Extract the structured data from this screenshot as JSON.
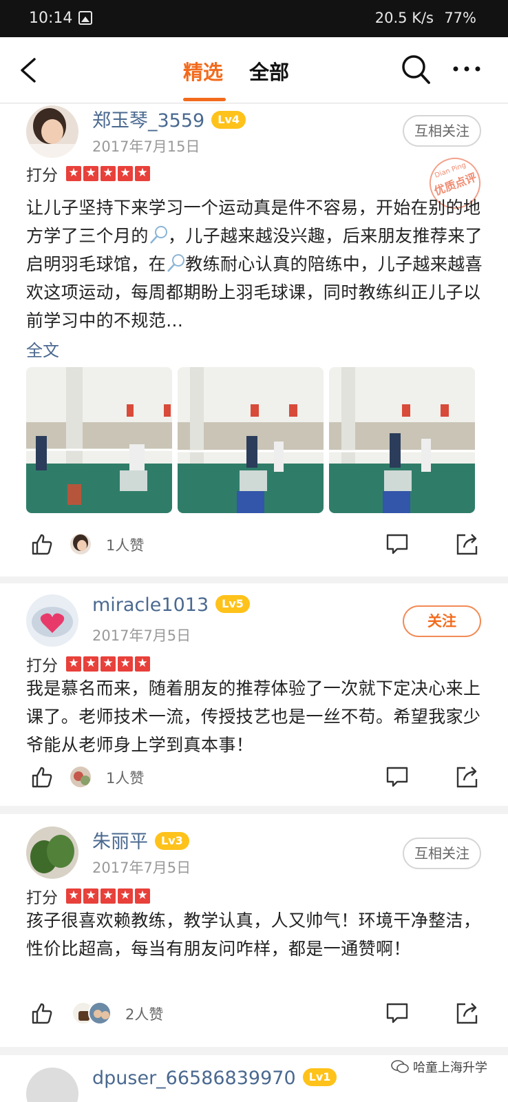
{
  "status_bar": {
    "time": "10:14",
    "network_speed": "20.5 K/s",
    "battery": "77%"
  },
  "nav": {
    "tab_selected": "精选",
    "tab_all": "全部"
  },
  "reviews": [
    {
      "username": "郑玉琴_3559",
      "level": "Lv4",
      "date": "2017年7月15日",
      "follow_label": "互相关注",
      "rating_label": "打分",
      "rating_stars": 5,
      "stamp_top": "Dian Ping",
      "stamp_text": "优质点评",
      "text_parts": [
        "让儿子坚持下来学习一个运动真是件不容易，开始在别的地方学了三个月的",
        "，儿子越来越没兴趣，后来朋友推荐来了启明羽毛球馆，在",
        "教练耐心认真的陪练中，儿子越来越喜欢这项运动，每周都期盼上羽毛球课，同时教练纠正儿子以前学习中的不规范..."
      ],
      "full_text_link": "全文",
      "likes": "1人赞"
    },
    {
      "username": "miracle1013",
      "level": "Lv5",
      "date": "2017年7月5日",
      "follow_label": "关注",
      "rating_label": "打分",
      "rating_stars": 5,
      "text": "我是慕名而来，随着朋友的推荐体验了一次就下定决心来上课了。老师技术一流，传授技艺也是一丝不苟。希望我家少爷能从老师身上学到真本事！",
      "likes": "1人赞"
    },
    {
      "username": "朱丽平",
      "level": "Lv3",
      "date": "2017年7月5日",
      "follow_label": "互相关注",
      "rating_label": "打分",
      "rating_stars": 5,
      "text": "孩子很喜欢赖教练，教学认真，人又帅气！环境干净整洁，性价比超高，每当有朋友问咋样，都是一通赞啊！",
      "likes": "2人赞"
    },
    {
      "username": "dpuser_66586839970",
      "level": "Lv1"
    }
  ],
  "watermark": "哈童上海升学",
  "colors": {
    "accent": "#f26b1d",
    "username": "#4a6990",
    "level_badge": "#ffc21a",
    "star": "#e8403a"
  }
}
